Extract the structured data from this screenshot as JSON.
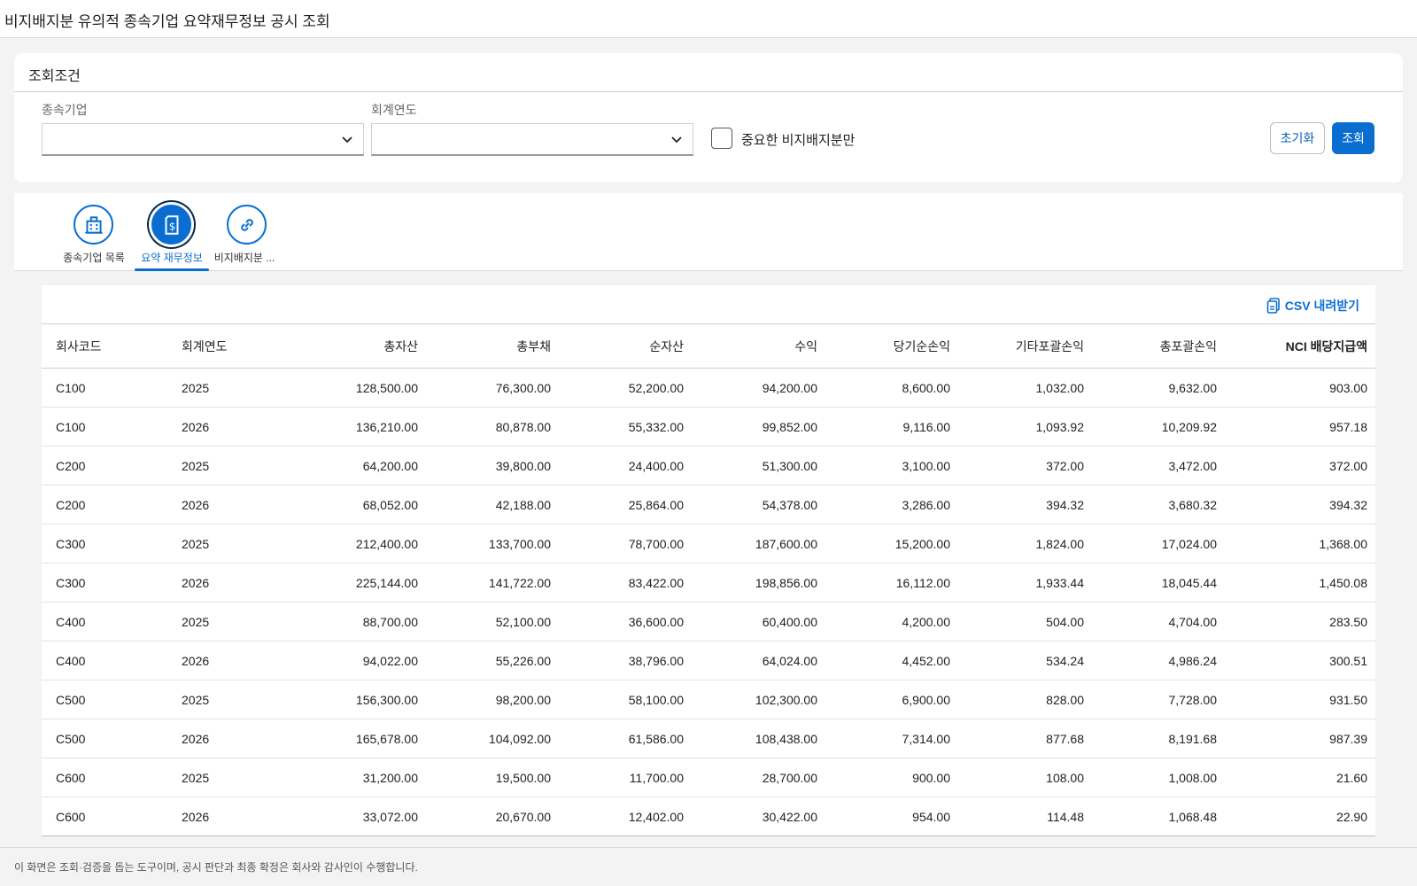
{
  "header": {
    "title": "비지배지분 유의적 종속기업 요약재무정보 공시 조회"
  },
  "conditions": {
    "title": "조회조건",
    "subsidiary_label": "종속기업",
    "subsidiary_value": "",
    "fiscal_year_label": "회계연도",
    "fiscal_year_value": "",
    "significant_only_label": "중요한 비지배지분만",
    "significant_only_checked": false,
    "reset_label": "초기화",
    "search_label": "조회"
  },
  "tabs": [
    {
      "label": "종속기업 목록",
      "icon": "building-icon",
      "active": false
    },
    {
      "label": "요약 재무정보",
      "icon": "finance-document-icon",
      "active": true
    },
    {
      "label": "비지배지분 ...",
      "icon": "link-icon",
      "active": false
    }
  ],
  "table": {
    "csv_label": "CSV 내려받기",
    "columns": [
      "회사코드",
      "회계연도",
      "총자산",
      "총부채",
      "순자산",
      "수익",
      "당기순손익",
      "기타포괄손익",
      "총포괄손익",
      "NCI 배당지급액"
    ],
    "rows": [
      [
        "C100",
        "2025",
        "128,500.00",
        "76,300.00",
        "52,200.00",
        "94,200.00",
        "8,600.00",
        "1,032.00",
        "9,632.00",
        "903.00"
      ],
      [
        "C100",
        "2026",
        "136,210.00",
        "80,878.00",
        "55,332.00",
        "99,852.00",
        "9,116.00",
        "1,093.92",
        "10,209.92",
        "957.18"
      ],
      [
        "C200",
        "2025",
        "64,200.00",
        "39,800.00",
        "24,400.00",
        "51,300.00",
        "3,100.00",
        "372.00",
        "3,472.00",
        "372.00"
      ],
      [
        "C200",
        "2026",
        "68,052.00",
        "42,188.00",
        "25,864.00",
        "54,378.00",
        "3,286.00",
        "394.32",
        "3,680.32",
        "394.32"
      ],
      [
        "C300",
        "2025",
        "212,400.00",
        "133,700.00",
        "78,700.00",
        "187,600.00",
        "15,200.00",
        "1,824.00",
        "17,024.00",
        "1,368.00"
      ],
      [
        "C300",
        "2026",
        "225,144.00",
        "141,722.00",
        "83,422.00",
        "198,856.00",
        "16,112.00",
        "1,933.44",
        "18,045.44",
        "1,450.08"
      ],
      [
        "C400",
        "2025",
        "88,700.00",
        "52,100.00",
        "36,600.00",
        "60,400.00",
        "4,200.00",
        "504.00",
        "4,704.00",
        "283.50"
      ],
      [
        "C400",
        "2026",
        "94,022.00",
        "55,226.00",
        "38,796.00",
        "64,024.00",
        "4,452.00",
        "534.24",
        "4,986.24",
        "300.51"
      ],
      [
        "C500",
        "2025",
        "156,300.00",
        "98,200.00",
        "58,100.00",
        "102,300.00",
        "6,900.00",
        "828.00",
        "7,728.00",
        "931.50"
      ],
      [
        "C500",
        "2026",
        "165,678.00",
        "104,092.00",
        "61,586.00",
        "108,438.00",
        "7,314.00",
        "877.68",
        "8,191.68",
        "987.39"
      ],
      [
        "C600",
        "2025",
        "31,200.00",
        "19,500.00",
        "11,700.00",
        "28,700.00",
        "900.00",
        "108.00",
        "1,008.00",
        "21.60"
      ],
      [
        "C600",
        "2026",
        "33,072.00",
        "20,670.00",
        "12,402.00",
        "30,422.00",
        "954.00",
        "114.48",
        "1,068.48",
        "22.90"
      ]
    ]
  },
  "footer": {
    "note": "이 화면은 조회·검증을 돕는 도구이며, 공시 판단과 최종 확정은 회사와 감사인이 수행합니다."
  },
  "colors": {
    "accent": "#0a6ed1",
    "background": "#f3f3f4"
  }
}
